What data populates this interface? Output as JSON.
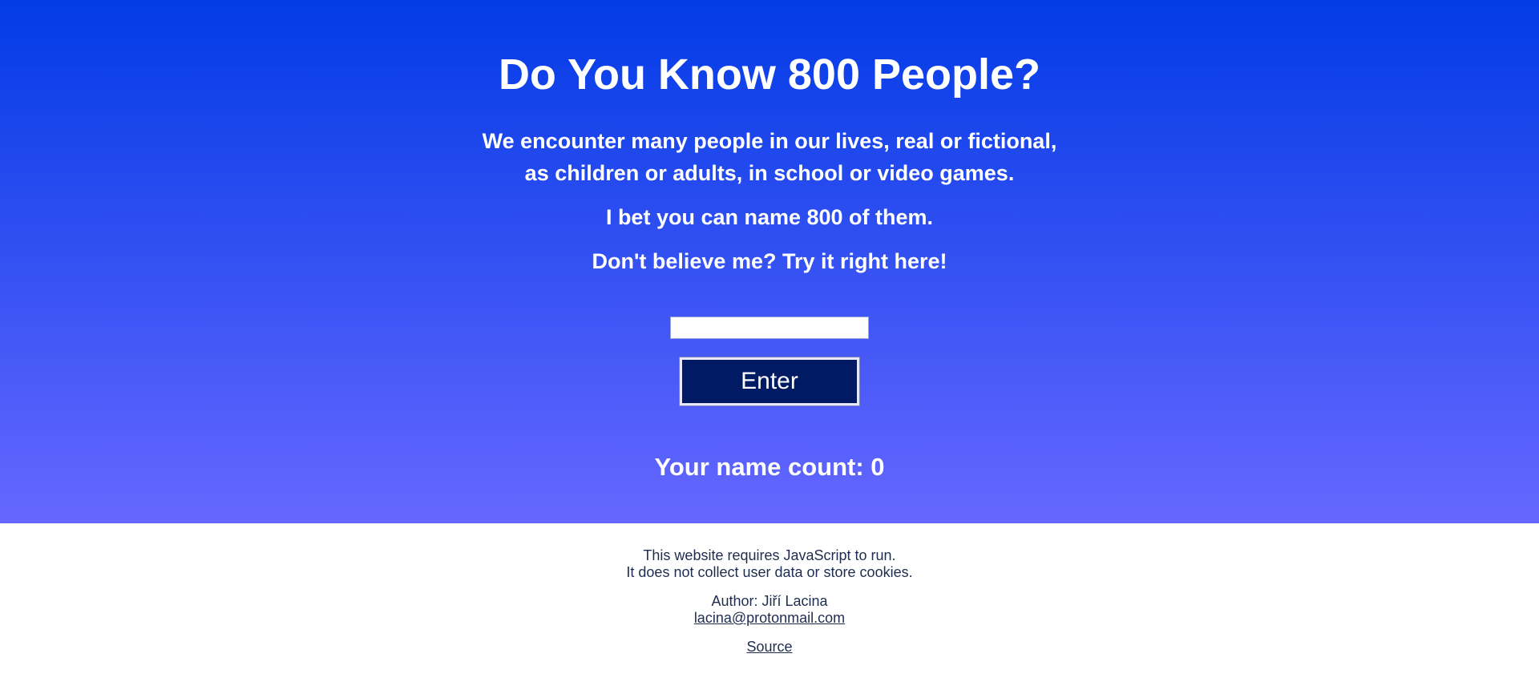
{
  "hero": {
    "title": "Do You Know 800 People?",
    "intro_line1": "We encounter many people in our lives, real or fictional,",
    "intro_line2": "as children or adults, in school or video games.",
    "bet_line": "I bet you can name 800 of them.",
    "challenge_line": "Don't believe me? Try it right here!",
    "input_value": "",
    "enter_label": "Enter",
    "count_label": "Your name count: 0"
  },
  "footer": {
    "js_notice": "This website requires JavaScript to run.",
    "privacy_notice": "It does not collect user data or store cookies.",
    "author": "Author: Jiří Lacina",
    "email": "lacina@protonmail.com",
    "source_label": "Source"
  },
  "colors": {
    "gradient_top": "#023be6",
    "gradient_bottom": "#6667ff",
    "button_bg": "#001a63",
    "footer_text": "#1e2d4f"
  }
}
